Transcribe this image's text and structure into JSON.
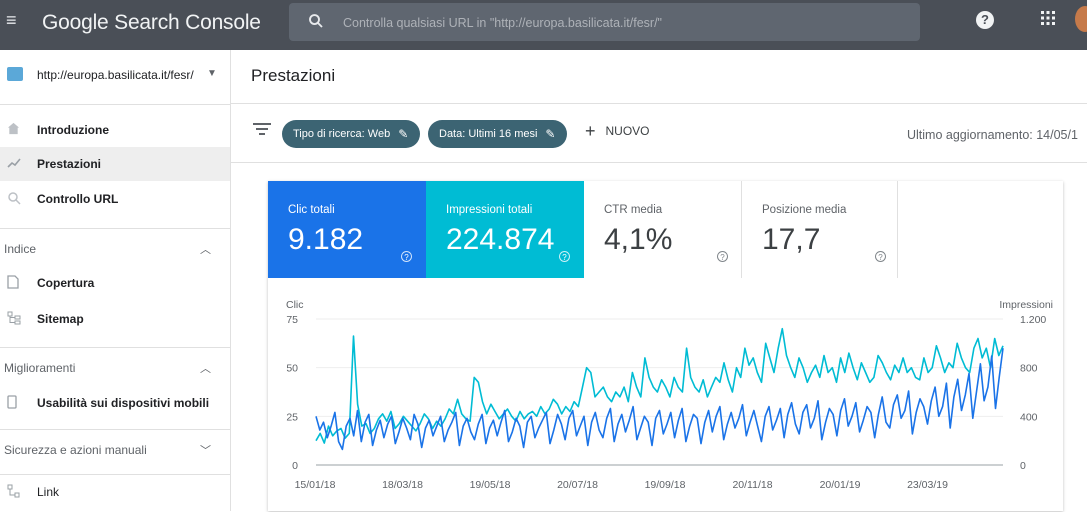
{
  "topbar": {
    "app_title": "Google Search Console",
    "search_placeholder": "Controlla qualsiasi URL in \"http://europa.basilicata.it/fesr/\"",
    "help_label": "?",
    "apps_label": "⋮⋮"
  },
  "sidebar": {
    "property": "http://europa.basilicata.it/fesr/",
    "nav": [
      {
        "label": "Introduzione",
        "icon": "home-icon",
        "active": false
      },
      {
        "label": "Prestazioni",
        "icon": "trend-icon",
        "active": true
      },
      {
        "label": "Controllo URL",
        "icon": "search-icon",
        "active": false
      }
    ],
    "sections": [
      {
        "label": "Indice",
        "expanded": true,
        "items": [
          {
            "label": "Copertura",
            "icon": "document-icon"
          },
          {
            "label": "Sitemap",
            "icon": "sitemap-icon"
          }
        ]
      },
      {
        "label": "Miglioramenti",
        "expanded": true,
        "items": [
          {
            "label": "Usabilità sui dispositivi mobili",
            "icon": "phone-icon"
          }
        ]
      },
      {
        "label": "Sicurezza e azioni manuali",
        "expanded": false,
        "items": []
      }
    ],
    "link_item": {
      "label": "Link",
      "icon": "link-icon"
    }
  },
  "page": {
    "title": "Prestazioni",
    "filters": [
      {
        "label": "Tipo di ricerca: Web"
      },
      {
        "label": "Data: Ultimi 16 mesi"
      }
    ],
    "new_label": "NUOVO",
    "last_update": "Ultimo aggiornamento: 14/05/1"
  },
  "metrics": [
    {
      "label": "Clic totali",
      "value": "9.182"
    },
    {
      "label": "Impressioni totali",
      "value": "224.874"
    },
    {
      "label": "CTR media",
      "value": "4,1%"
    },
    {
      "label": "Posizione media",
      "value": "17,7"
    }
  ],
  "colors": {
    "clicks": "#1a73e8",
    "impressions": "#00bcd4",
    "topbar": "#4a4f57",
    "chip": "#3c6473"
  },
  "chart_data": {
    "type": "line",
    "left_axis_label": "Clic",
    "right_axis_label": "Impressioni",
    "left_ticks": [
      "75",
      "50",
      "25",
      "0"
    ],
    "right_ticks": [
      "1.200",
      "800",
      "400",
      "0"
    ],
    "x_tick_labels": [
      "15/01/18",
      "18/03/18",
      "19/05/18",
      "20/07/18",
      "19/09/18",
      "20/11/18",
      "20/01/19",
      "23/03/19"
    ],
    "ylim_left": [
      0,
      75
    ],
    "ylim_right": [
      0,
      1200
    ],
    "series": [
      {
        "axis": "left",
        "color": "#1a73e8",
        "values": [
          25,
          18,
          22,
          14,
          20,
          27,
          12,
          8,
          20,
          24,
          15,
          28,
          12,
          22,
          26,
          10,
          18,
          23,
          14,
          21,
          25,
          11,
          17,
          24,
          19,
          13,
          26,
          21,
          9,
          19,
          23,
          15,
          20,
          25,
          12,
          18,
          22,
          27,
          10,
          20,
          24,
          17,
          13,
          21,
          26,
          11,
          19,
          23,
          15,
          22,
          28,
          12,
          17,
          24,
          20,
          9,
          22,
          25,
          14,
          19,
          23,
          27,
          11,
          18,
          26,
          21,
          13,
          24,
          28,
          15,
          20,
          25,
          10,
          22,
          27,
          18,
          14,
          24,
          29,
          12,
          21,
          26,
          17,
          23,
          30,
          13,
          19,
          25,
          22,
          10,
          24,
          28,
          16,
          21,
          27,
          14,
          23,
          29,
          12,
          20,
          26,
          24,
          11,
          22,
          28,
          17,
          25,
          30,
          13,
          21,
          27,
          19,
          24,
          31,
          15,
          22,
          28,
          20,
          12,
          25,
          30,
          18,
          23,
          29,
          14,
          26,
          32,
          21,
          16,
          27,
          31,
          19,
          24,
          33,
          13,
          22,
          29,
          26,
          15,
          28,
          34,
          20,
          25,
          32,
          17,
          23,
          30,
          27,
          14,
          26,
          35,
          22,
          19,
          31,
          36,
          24,
          28,
          38,
          16,
          27,
          34,
          30,
          21,
          33,
          40,
          25,
          30,
          42,
          19,
          35,
          44,
          28,
          36,
          47,
          24,
          38,
          52,
          33,
          40,
          56,
          29,
          45,
          60
        ]
      },
      {
        "axis": "right",
        "color": "#00bcd4",
        "values": [
          200,
          260,
          180,
          320,
          240,
          280,
          300,
          220,
          260,
          1060,
          500,
          320,
          340,
          260,
          300,
          380,
          420,
          360,
          440,
          300,
          340,
          400,
          360,
          320,
          280,
          340,
          420,
          380,
          300,
          360,
          320,
          380,
          460,
          420,
          540,
          420,
          380,
          360,
          720,
          680,
          520,
          420,
          500,
          440,
          380,
          420,
          460,
          400,
          360,
          440,
          380,
          420,
          440,
          400,
          480,
          420,
          460,
          540,
          500,
          420,
          480,
          440,
          520,
          480,
          640,
          800,
          760,
          560,
          600,
          640,
          560,
          520,
          600,
          560,
          640,
          520,
          760,
          640,
          560,
          880,
          720,
          640,
          600,
          700,
          640,
          560,
          720,
          640,
          600,
          960,
          720,
          640,
          600,
          700,
          560,
          640,
          720,
          680,
          840,
          700,
          600,
          800,
          720,
          960,
          820,
          880,
          760,
          680,
          1000,
          880,
          760,
          960,
          1120,
          900,
          800,
          720,
          880,
          800,
          680,
          760,
          820,
          720,
          900,
          760,
          800,
          680,
          880,
          760,
          920,
          800,
          700,
          840,
          760,
          680,
          720,
          900,
          840,
          760,
          700,
          820,
          760,
          880,
          760,
          800,
          720,
          700,
          880,
          760,
          800,
          980,
          880,
          760,
          840,
          800,
          1000,
          880,
          800,
          760,
          960,
          1040,
          880,
          960,
          800,
          1040,
          900,
          980
        ]
      }
    ]
  }
}
